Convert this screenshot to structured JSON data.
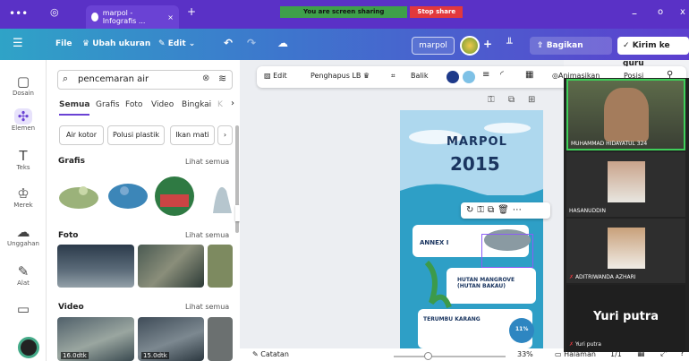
{
  "browser": {
    "tab_title": "marpol - Infografis ...",
    "share_banner": "You are screen sharing",
    "stop_share": "Stop share",
    "minimize": "–",
    "restore": "o",
    "close": "x"
  },
  "menubar": {
    "file": "File",
    "resize": "Ubah ukuran",
    "edit": "Edit",
    "project_name": "marpol",
    "share": "Bagikan",
    "send": "Kirim ke guru"
  },
  "rail": [
    {
      "label": "Dosain",
      "icon": "design-icon"
    },
    {
      "label": "Elemen",
      "icon": "elements-icon"
    },
    {
      "label": "Teks",
      "icon": "text-icon"
    },
    {
      "label": "Merek",
      "icon": "brand-icon"
    },
    {
      "label": "Unggahan",
      "icon": "upload-icon"
    },
    {
      "label": "Alat",
      "icon": "tools-icon"
    },
    {
      "label": "",
      "icon": "folder-icon"
    }
  ],
  "panel": {
    "search_value": "pencemaran air",
    "tabs": [
      "Semua",
      "Grafis",
      "Foto",
      "Video",
      "Bingkai"
    ],
    "chips": [
      "Air kotor",
      "Polusi plastik",
      "Ikan mati"
    ],
    "sections": {
      "grafis": {
        "title": "Grafis",
        "link": "Lihat semua"
      },
      "foto": {
        "title": "Foto",
        "link": "Lihat semua"
      },
      "video": {
        "title": "Video",
        "link": "Lihat semua",
        "durations": [
          "16.0dtk",
          "15.0dtk"
        ]
      }
    }
  },
  "toolbar": {
    "edit": "Edit",
    "bg_remover": "Penghapus LB",
    "flip": "Balik",
    "animate": "Animasikan",
    "position": "Posisi"
  },
  "poster": {
    "title_top": "MARPOL",
    "title_year": "2015",
    "annex": "ANNEX I",
    "mangrove": "HUTAN MANGROVE (HUTAN BAKAU)",
    "reef": "TERUMBU KARANG",
    "percent_badge": "11%"
  },
  "participants": [
    {
      "name": "MUHAMMAD HIDAYATUL 324"
    },
    {
      "name": "HASANUDDIN"
    },
    {
      "name": "ADITRIWANDA AZHARI"
    },
    {
      "name": "Yuri putra",
      "big_name": "Yuri putra"
    }
  ],
  "bottombar": {
    "notes": "Catatan",
    "zoom": "33%",
    "pages": "Halaman",
    "page_count": "1/1"
  },
  "colors": {
    "brand_purple": "#5a31c6",
    "teal": "#2fa3c7",
    "share_green": "#3ea04a",
    "stop_red": "#e2383d"
  }
}
